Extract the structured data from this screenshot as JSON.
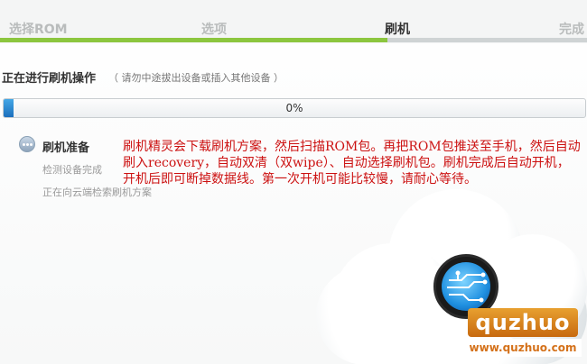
{
  "steps": {
    "labels": [
      "选择ROM",
      "选项",
      "刷机",
      "完成"
    ],
    "active_index": 2,
    "progress_fraction": 0.66
  },
  "operation": {
    "title": "正在进行刷机操作",
    "note": "（ 请勿中途拔出设备或插入其他设备 ）",
    "progress_text": "0%",
    "progress_fraction": 0.0
  },
  "task": {
    "title": "刷机准备",
    "sub1": "检测设备完成",
    "sub2": "正在向云端检索刷机方案"
  },
  "annotation": "刷机精灵会下载刷机方案，然后扫描ROM包。再把ROM包推送至手机，然后自动刷入recovery，自动双清（双wipe）、自动选择刷机包。刷机完成后自动开机，开机后即可断掉数据线。第一次开机可能比较慢，请耐心等待。",
  "watermark": {
    "logo": "quzhuo",
    "url": "www.quzhuo.com"
  },
  "colors": {
    "step_done": "#8cc63f",
    "progress_blue": "#1b6fbd",
    "annotation_red": "#cc1111",
    "watermark_orange": "#d4711a"
  },
  "icons": {
    "task": "ellipsis-icon",
    "cloud": "cloud-illustration",
    "tech": "circuit-board-icon"
  }
}
